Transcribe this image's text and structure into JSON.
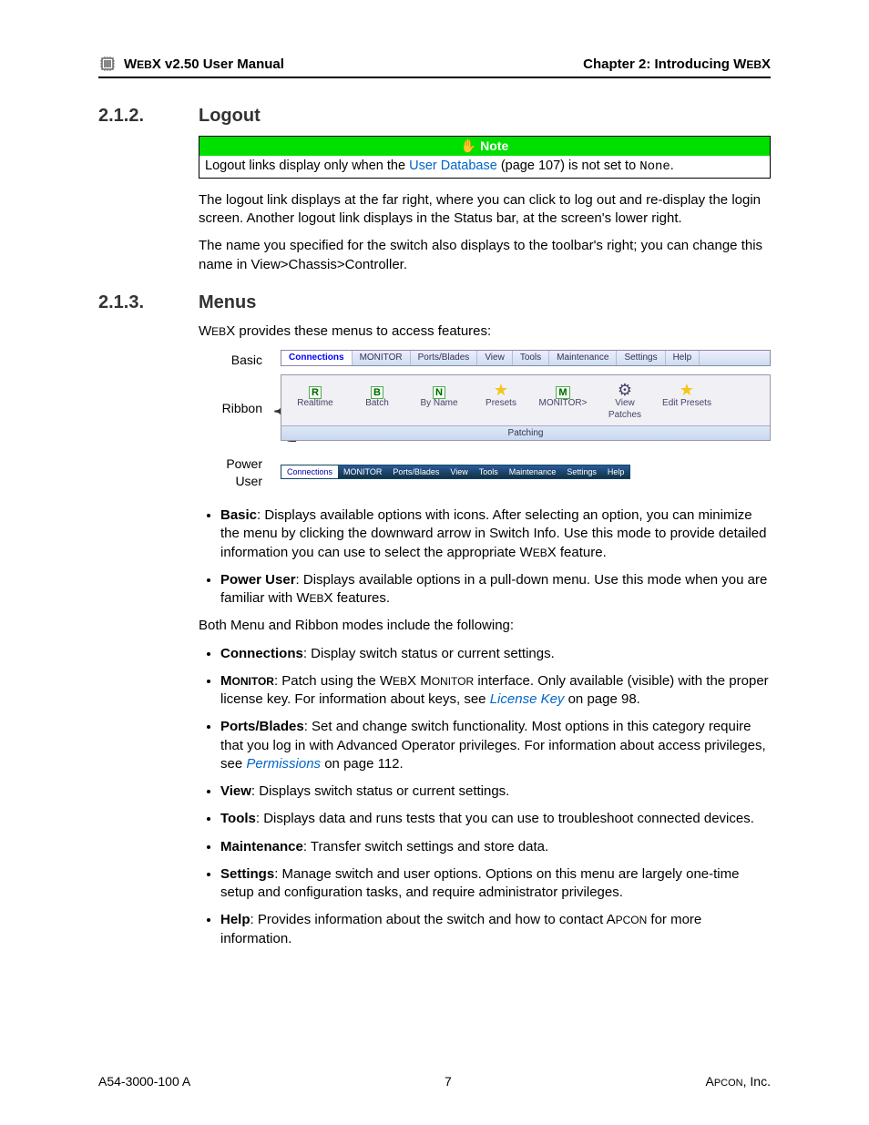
{
  "header": {
    "left_prefix": "W",
    "left_sc": "EB",
    "left_rest": "X v2.50 User Manual",
    "right_prefix": "Chapter 2: Introducing W",
    "right_sc": "EB",
    "right_suffix": "X"
  },
  "section212": {
    "num": "2.1.2.",
    "title": "Logout",
    "note_label": "Note",
    "note_pre": "Logout links display only when the ",
    "note_link": "User Database",
    "note_post": " (page 107) is not set to ",
    "note_mono": "None",
    "note_end": ".",
    "para1": "The logout link displays at the far right, where you can click to log out and re-display the login screen. Another logout link  displays in the Status bar, at the screen's lower right.",
    "para2": "The name you specified for the switch also displays to the toolbar's right; you can change this name in View>Chassis>Controller."
  },
  "section213": {
    "num": "2.1.3.",
    "title": "Menus",
    "intro_pre": "W",
    "intro_sc": "EB",
    "intro_post": "X provides these menus to access features:",
    "fig": {
      "basic_label": "Basic",
      "ribbon_label": "Ribbon",
      "power_label": "Power User",
      "menu_items": [
        "Connections",
        "MONITOR",
        "Ports/Blades",
        "View",
        "Tools",
        "Maintenance",
        "Settings",
        "Help"
      ],
      "ribbon_items": [
        {
          "icon": "R",
          "label": "Realtime"
        },
        {
          "icon": "B",
          "label": "Batch"
        },
        {
          "icon": "N",
          "label": "By Name"
        },
        {
          "icon": "★",
          "label": "Presets"
        },
        {
          "icon": "M",
          "label": "MONITOR>"
        },
        {
          "icon": "⚙",
          "label": "View Patches"
        },
        {
          "icon": "★",
          "label": "Edit Presets"
        }
      ],
      "patching": "Patching"
    },
    "bullets1": [
      {
        "strong": "Basic",
        "text": ": Displays available options with icons. After selecting an option, you can minimize the menu by clicking the downward arrow in Switch Info. Use this mode to provide detailed information you can use to select the appropriate W",
        "sc": "EB",
        "text2": "X feature."
      },
      {
        "strong": "Power User",
        "text": ": Displays available options in a pull-down menu. Use this mode when you are familiar with W",
        "sc": "EB",
        "text2": "X features."
      }
    ],
    "mid": "Both Menu and Ribbon modes include the following:",
    "bullets2": [
      {
        "strong": "Connections",
        "rest": ": Display switch status or current settings."
      },
      {
        "strong_sc": "MONITOR",
        "rest_a": ": Patch using the W",
        "rest_sc": "EB",
        "rest_b": "X M",
        "rest_sc2": "ONITOR",
        "rest_c": " interface. Only available (visible) with the proper license key. For information about keys, see ",
        "link": "License Key",
        "rest_d": " on page 98."
      },
      {
        "strong": "Ports/Blades",
        "rest_a": ": Set and change switch functionality. Most options in this category require that you log in with Advanced Operator privileges. For information about access privileges, see ",
        "link": "Permissions",
        "rest_b": " on page 112."
      },
      {
        "strong": "View",
        "rest": ": Displays switch status or current settings."
      },
      {
        "strong": "Tools",
        "rest": ": Displays data and runs tests that you can use to troubleshoot connected devices."
      },
      {
        "strong": "Maintenance",
        "rest": ": Transfer switch settings and store data."
      },
      {
        "strong": "Settings",
        "rest": ": Manage switch and user options. Options on this menu are largely one-time setup and configuration tasks, and require administrator privileges."
      },
      {
        "strong": "Help",
        "rest_a": ": Provides information about the switch and how to contact A",
        "rest_sc": "PCON",
        "rest_b": " for more information."
      }
    ]
  },
  "footer": {
    "left": "A54-3000-100 A",
    "center": "7",
    "right_a": "A",
    "right_sc": "PCON",
    "right_b": ", Inc."
  }
}
